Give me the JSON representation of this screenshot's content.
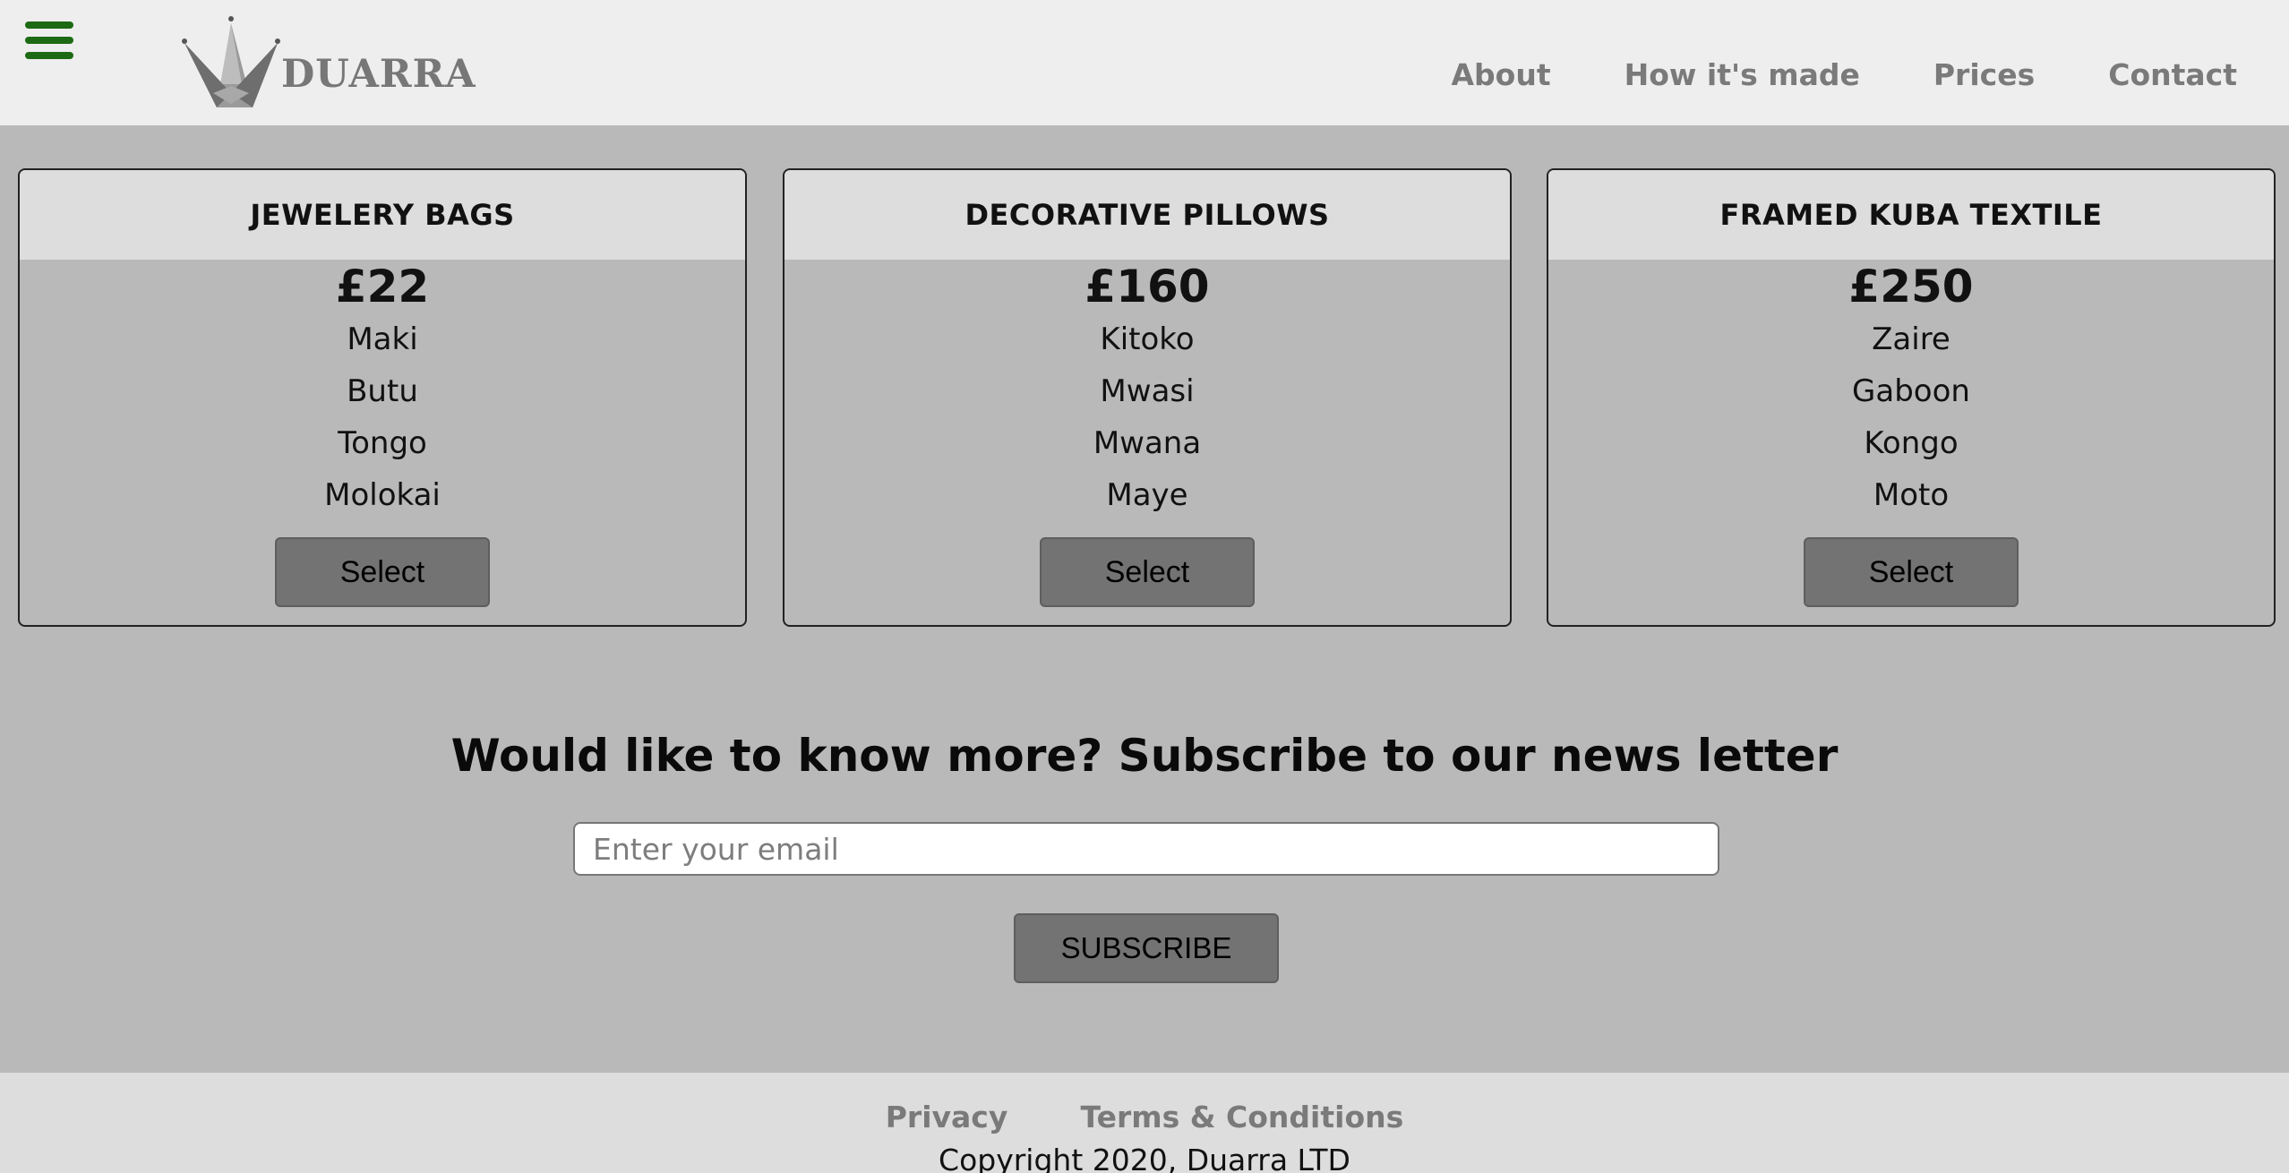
{
  "brand": {
    "name": "DUARRA"
  },
  "nav": {
    "items": [
      "About",
      "How it's made",
      "Prices",
      "Contact"
    ]
  },
  "cards": [
    {
      "title": "JEWELERY BAGS",
      "price": "£22",
      "items": [
        "Maki",
        "Butu",
        "Tongo",
        "Molokai"
      ],
      "button": "Select"
    },
    {
      "title": "DECORATIVE PILLOWS",
      "price": "£160",
      "items": [
        "Kitoko",
        "Mwasi",
        "Mwana",
        "Maye"
      ],
      "button": "Select"
    },
    {
      "title": "FRAMED KUBA TEXTILE",
      "price": "£250",
      "items": [
        "Zaire",
        "Gaboon",
        "Kongo",
        "Moto"
      ],
      "button": "Select"
    }
  ],
  "newsletter": {
    "title": "Would like to know more? Subscribe to our news letter",
    "placeholder": "Enter your email",
    "button": "SUBSCRIBE"
  },
  "footer": {
    "links": [
      "Privacy",
      "Terms & Conditions"
    ],
    "copyright": "Copyright 2020, Duarra LTD"
  },
  "colors": {
    "menu_icon": "#1d6a14",
    "page_bg": "#b9b9b9",
    "header_bg": "#eeeeee",
    "card_header_bg": "#dddddd",
    "button_bg": "#737373",
    "link_gray": "#7a7a7a"
  },
  "icons": [
    "hamburger-menu-icon",
    "crown-logo-icon"
  ]
}
